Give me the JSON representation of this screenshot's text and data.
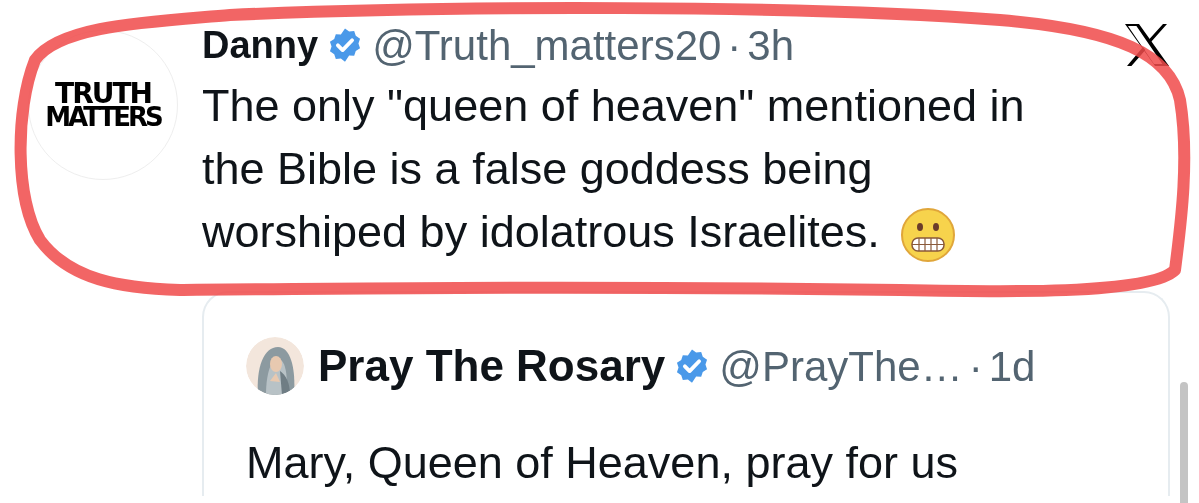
{
  "tweet": {
    "avatar_logo": [
      "TRUTH",
      "MATTERS"
    ],
    "name": "Danny",
    "verified": true,
    "handle": "@Truth_matters20",
    "separator": "·",
    "time": "3h",
    "text_lines": [
      "The only \"queen of heaven\" mentioned in",
      "the Bible is a false goddess being",
      "worshiped by idolatrous Israelites."
    ],
    "quoted_tweet": {
      "name": "Pray The Rosary",
      "verified": true,
      "handle": "@PrayThe…",
      "separator": "·",
      "time": "1d",
      "text": "Mary, Queen of Heaven, pray for us"
    }
  }
}
